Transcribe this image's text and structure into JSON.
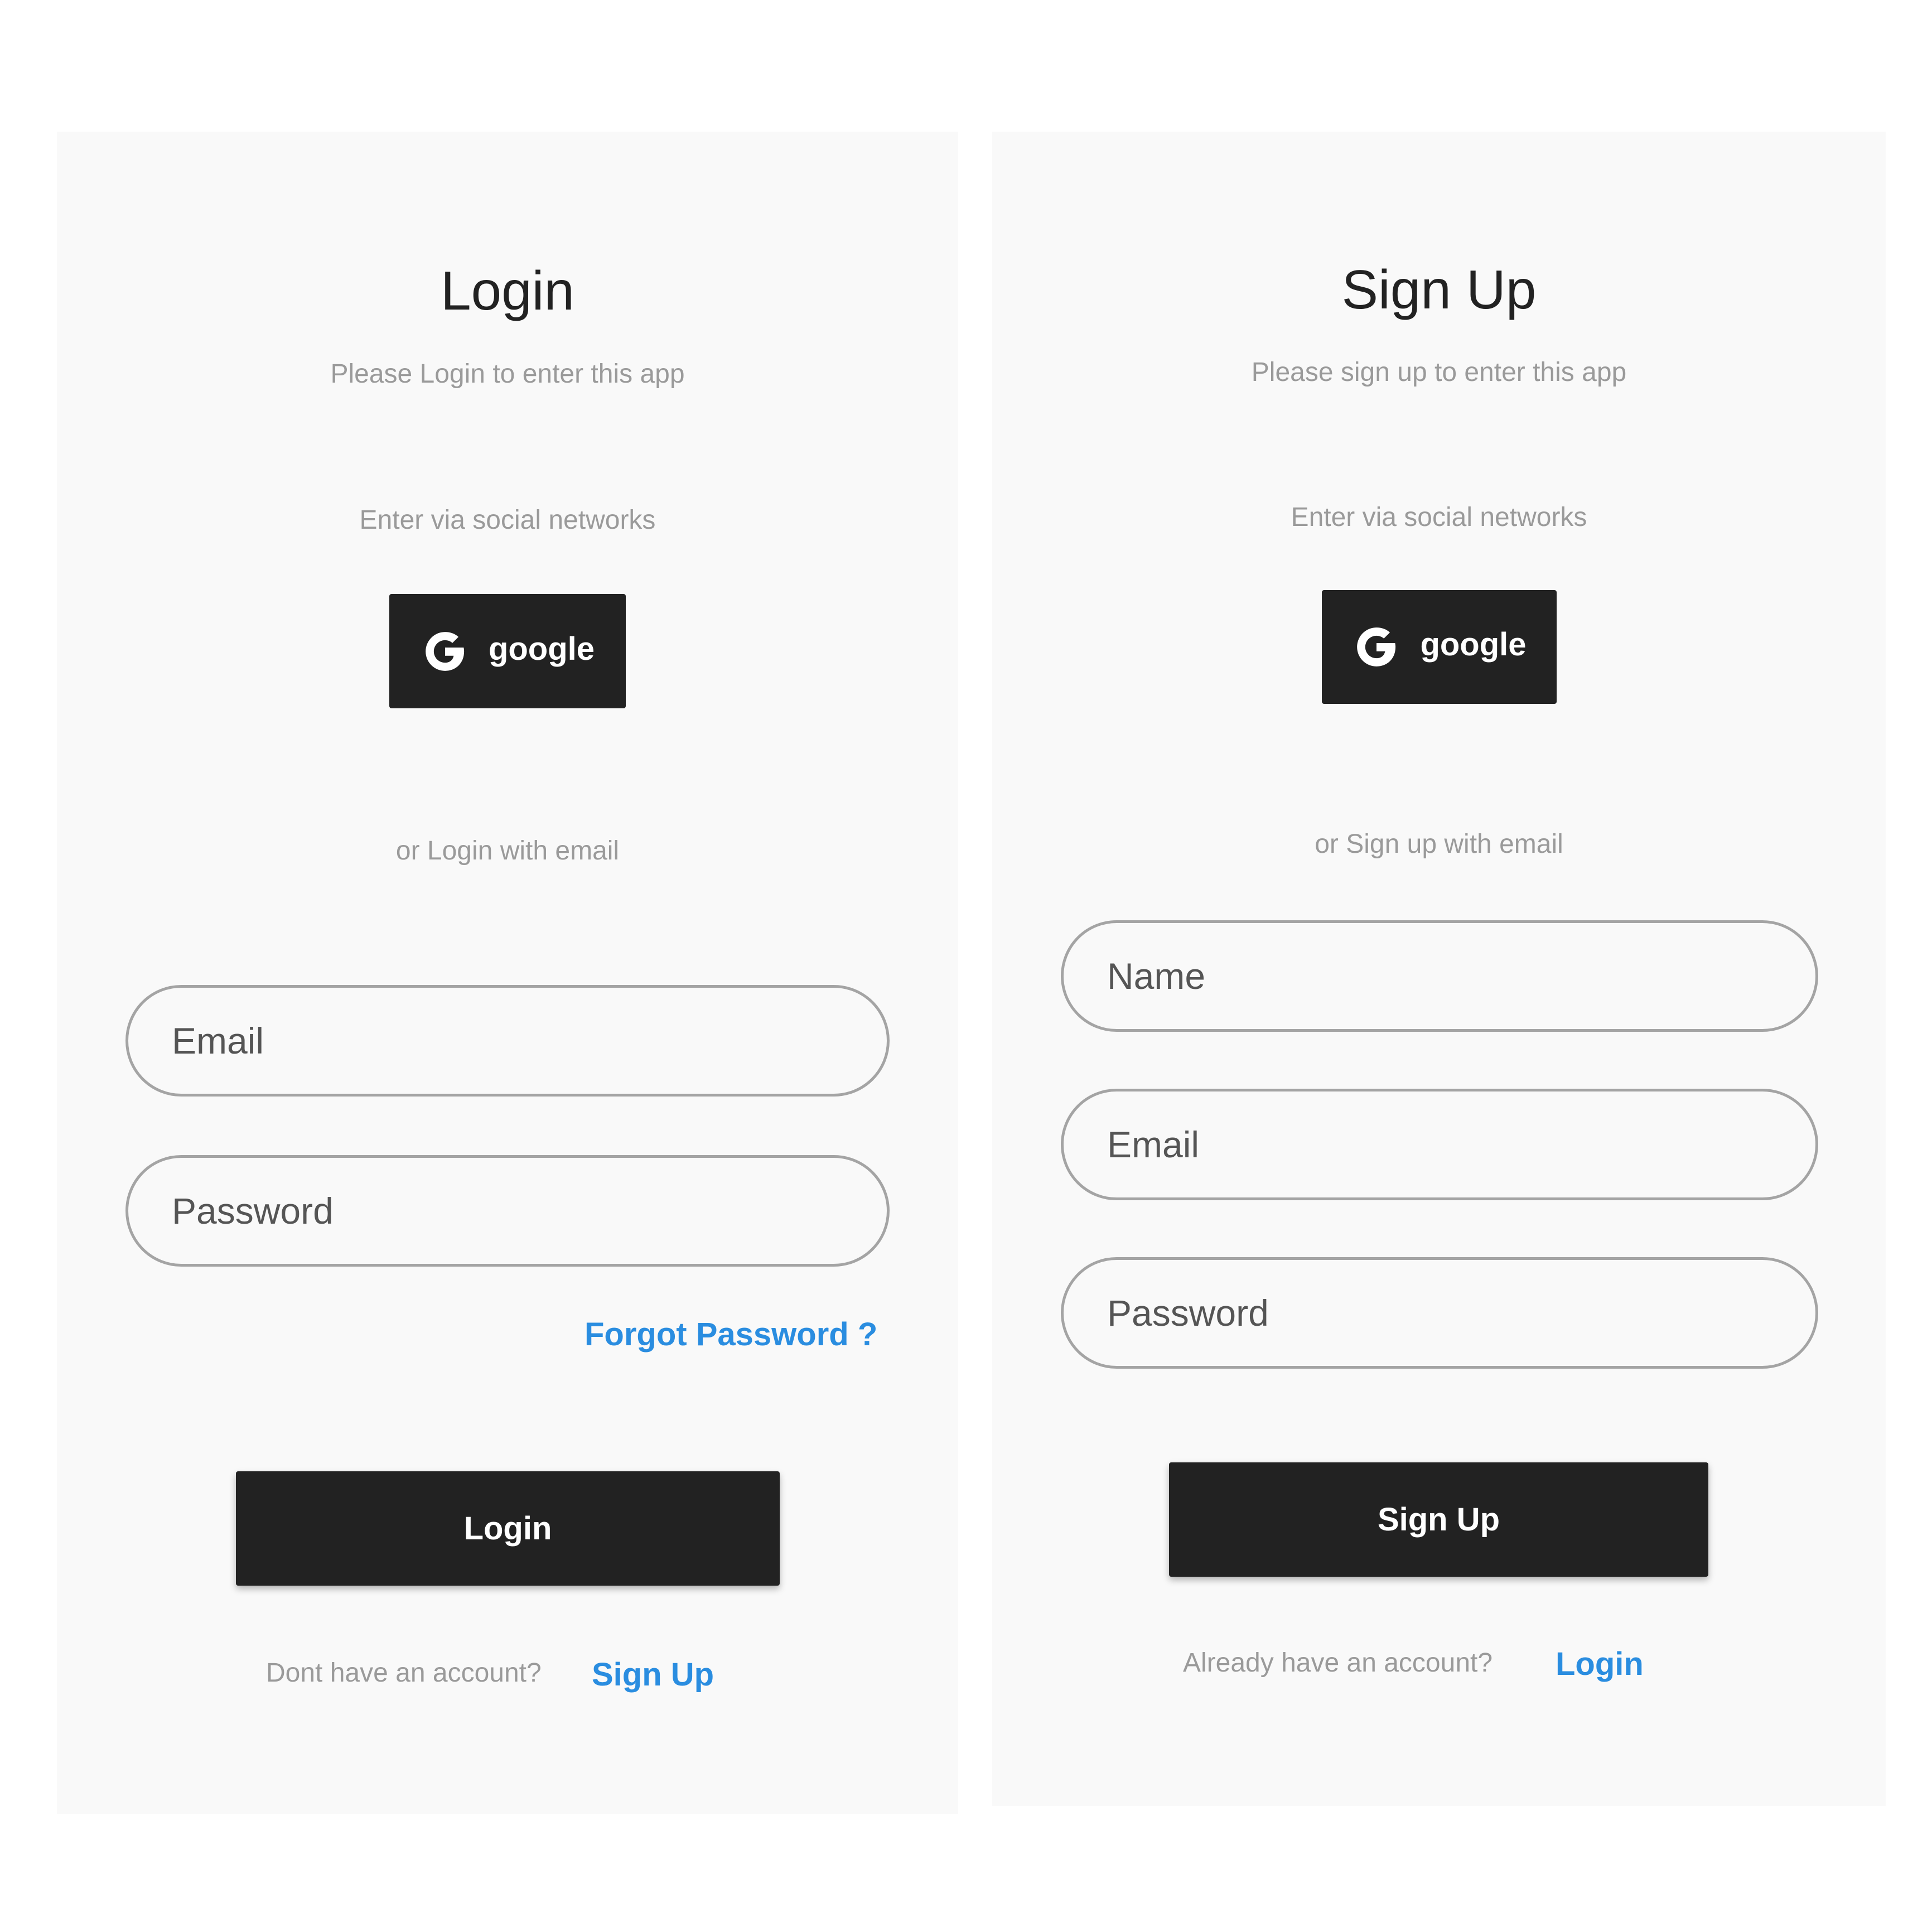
{
  "colors": {
    "panel_background": "#f9f9f9",
    "text_dark": "#222222",
    "text_muted": "#9a9a9a",
    "link": "#2a8de0",
    "button_background": "#222222",
    "field_border": "#a4a4a4"
  },
  "login": {
    "title": "Login",
    "subtitle": "Please Login to enter this app",
    "social_label": "Enter via social networks",
    "google_button": {
      "icon": "google-g-icon",
      "label": "google"
    },
    "email_divider": "or Login with email",
    "email_field": {
      "placeholder": "Email",
      "value": ""
    },
    "password_field": {
      "placeholder": "Password",
      "value": ""
    },
    "forgot_password": "Forgot Password ?",
    "submit_label": "Login",
    "footer_text": "Dont have an account?",
    "footer_link": "Sign Up"
  },
  "signup": {
    "title": "Sign Up",
    "subtitle": "Please sign up to enter this app",
    "social_label": "Enter via social networks",
    "google_button": {
      "icon": "google-g-icon",
      "label": "google"
    },
    "email_divider": "or Sign up with email",
    "name_field": {
      "placeholder": "Name",
      "value": ""
    },
    "email_field": {
      "placeholder": "Email",
      "value": ""
    },
    "password_field": {
      "placeholder": "Password",
      "value": ""
    },
    "submit_label": "Sign Up",
    "footer_text": "Already have an account?",
    "footer_link": "Login"
  }
}
